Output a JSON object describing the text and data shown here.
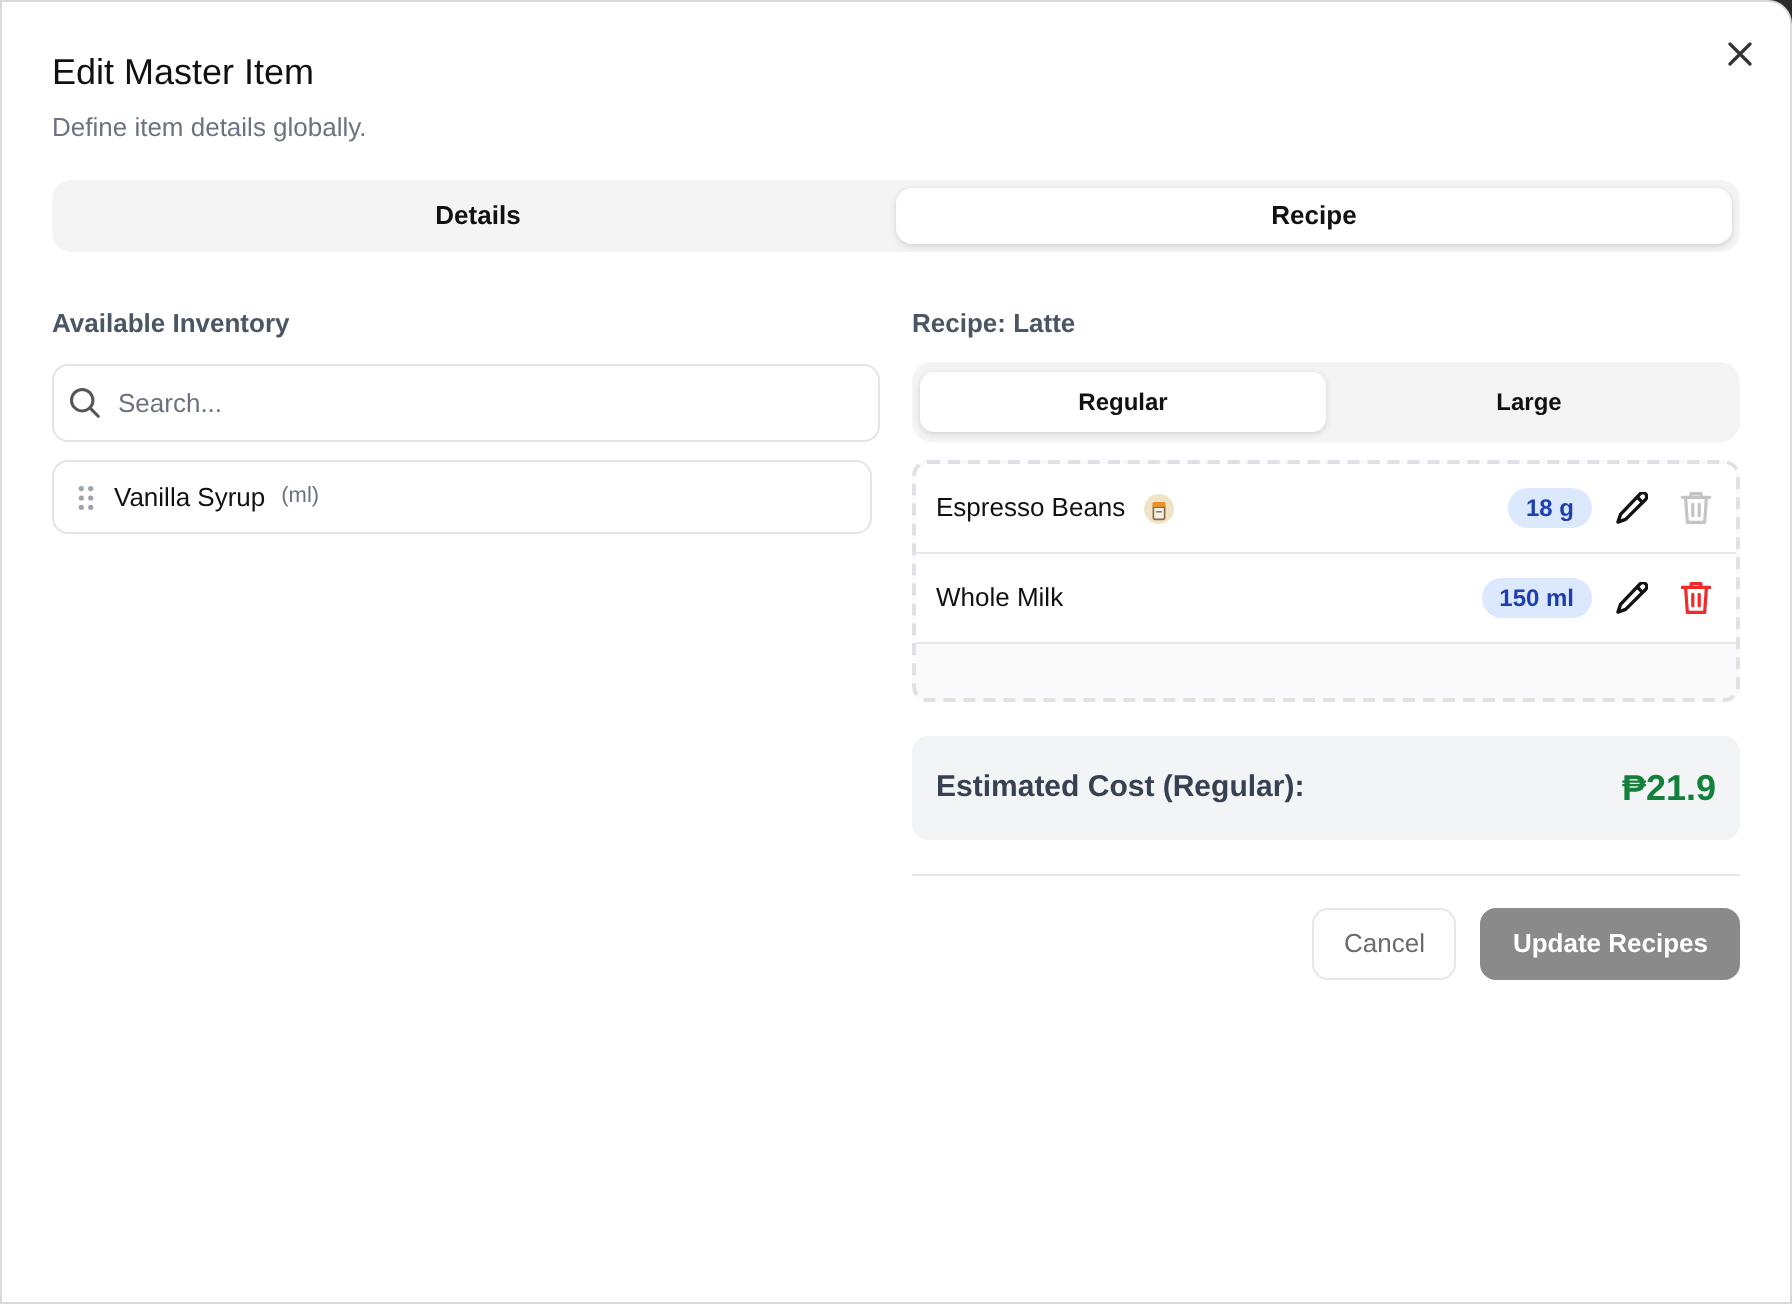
{
  "dialog": {
    "title": "Edit Master Item",
    "subtitle": "Define item details globally."
  },
  "tabs": [
    {
      "label": "Details",
      "selected": false
    },
    {
      "label": "Recipe",
      "selected": true
    }
  ],
  "inventory": {
    "heading": "Available Inventory",
    "search": {
      "placeholder": "Search..."
    },
    "items": [
      {
        "name": "Vanilla Syrup",
        "unit": "(ml)"
      }
    ]
  },
  "recipe": {
    "heading": "Recipe: **Latte**",
    "sizes": [
      {
        "label": "Regular",
        "selected": true
      },
      {
        "label": "Large",
        "selected": false
      }
    ],
    "ingredients": [
      {
        "name": "Espresso Beans",
        "flagged": true,
        "quantity": "18 g",
        "delete_enabled": false
      },
      {
        "name": "Whole Milk",
        "flagged": false,
        "quantity": "150 ml",
        "delete_enabled": true
      }
    ],
    "cost_label": "Estimated Cost (Regular):",
    "cost_value": "₱21.9"
  },
  "buttons": [
    {
      "label": "Cancel",
      "kind": "outline",
      "disabled": false
    },
    {
      "label": "Update Recipes",
      "kind": "primary",
      "disabled": true
    }
  ]
}
